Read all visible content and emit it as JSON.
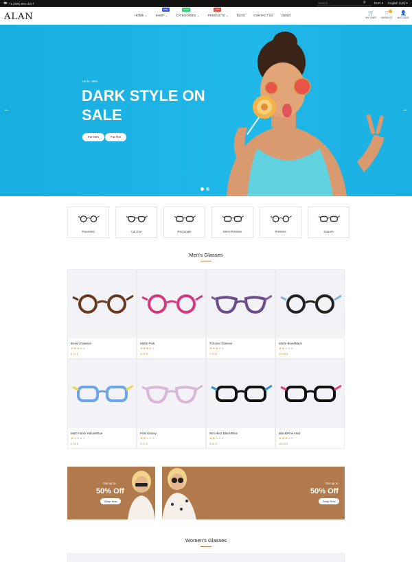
{
  "topbar": {
    "phone": "+1 (000) 681-3277",
    "search_placeholder": "Search...",
    "currency": "EUR",
    "language": "English (US)"
  },
  "header": {
    "logo": "ALAN",
    "nav": [
      {
        "label": "HOME",
        "has_dropdown": true
      },
      {
        "label": "SHOP",
        "has_dropdown": true,
        "badge": "NEW",
        "badge_color": "#3b5bdb"
      },
      {
        "label": "CATEGORIES",
        "has_dropdown": true,
        "badge": "SALE",
        "badge_color": "#2ecc71"
      },
      {
        "label": "PRODUCTS",
        "has_dropdown": true,
        "badge": "HOT",
        "badge_color": "#e74c3c"
      },
      {
        "label": "BLOG",
        "has_dropdown": false
      },
      {
        "label": "CONTACT US",
        "has_dropdown": false
      },
      {
        "label": "DEMO",
        "has_dropdown": false
      }
    ],
    "icons": [
      {
        "label": "MY CART",
        "icon": "cart-icon",
        "glyph": "🛒"
      },
      {
        "label": "WISHLIST",
        "icon": "heart-icon",
        "glyph": "♡",
        "count": "0"
      },
      {
        "label": "ACCOUNT",
        "icon": "user-icon",
        "glyph": "👤"
      }
    ]
  },
  "hero": {
    "subtitle": "Up to -50%",
    "title": "DARK STYLE ON SALE",
    "buttons": [
      "For Him",
      "For Her"
    ],
    "bg_color": "#1fb6e4"
  },
  "categories": [
    "Rounded",
    "Cat Eye",
    "Rectangle",
    "Semi-Rimless",
    "Rimless",
    "Square"
  ],
  "mens": {
    "title": "Men's Glasses",
    "products": [
      {
        "name": "Brown Glasses",
        "rating": 3,
        "price": "6.14 €",
        "frame": "#6b3a1e",
        "temple": "#5a3418"
      },
      {
        "name": "Matte Pink",
        "rating": 3,
        "price": "5.61 €",
        "frame": "#d6387f",
        "temple": "#d6387f"
      },
      {
        "name": "Tortoise Glasses",
        "rating": 3,
        "price": "7.19 €",
        "frame": "#6a4b8c",
        "temple": "#7a5aa0"
      },
      {
        "name": "Matte Blue/Black",
        "rating": 2,
        "price": "13.08 €",
        "frame": "#222222",
        "temple": "#7fb2e0"
      },
      {
        "name": "Matt Finish Yellow/Blue",
        "rating": 1,
        "price": "6.16 €",
        "frame": "#6aa6e8",
        "temple": "#f2d640"
      },
      {
        "name": "Pink Glossy",
        "rating": 2,
        "price": "5.67 €",
        "frame": "#d9b7d6",
        "temple": "#d9b7d6"
      },
      {
        "name": "Rim Rect Black/Blue",
        "rating": 2,
        "price": "5.81 €",
        "frame": "#111111",
        "temple": "#2f8fe0"
      },
      {
        "name": "Black/Pink Matt",
        "rating": 3,
        "price": "16.03 €",
        "frame": "#111111",
        "temple": "#e8417e"
      }
    ]
  },
  "banners": [
    {
      "small": "Get up to",
      "big": "50% Off",
      "button": "Shop Now"
    },
    {
      "small": "Get up to",
      "big": "50% Off",
      "button": "Shop Now"
    }
  ],
  "womens": {
    "title": "Women's Glasses"
  },
  "colors": {
    "accent": "#c8874f",
    "price": "#e08a2c",
    "star": "#f5a623",
    "banner": "#b07a4d"
  }
}
